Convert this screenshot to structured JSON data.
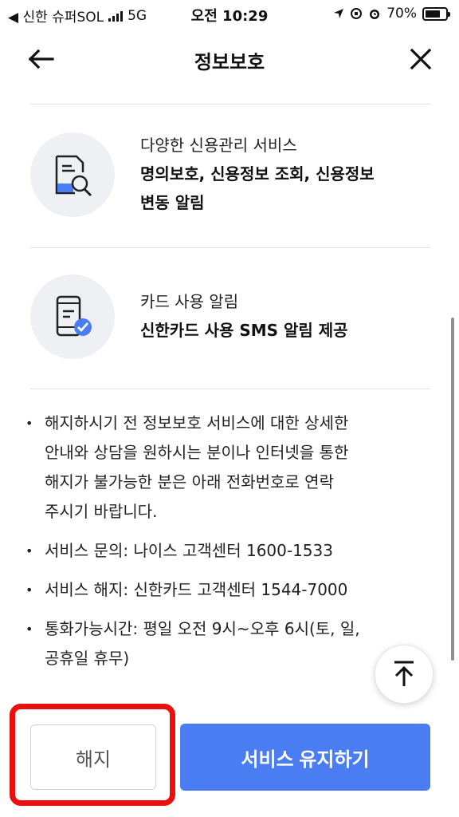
{
  "status_bar": {
    "carrier": "◀ 신한 슈퍼SOL",
    "network": "5G",
    "time": "오전 10:29",
    "battery": "70%"
  },
  "header": {
    "title": "정보보호"
  },
  "features": [
    {
      "icon": "document-search-icon",
      "subtitle": "다양한 신용관리 서비스",
      "title_line1": "명의보호, 신용정보 조회, 신용정보",
      "title_line2": "변동 알림"
    },
    {
      "icon": "phone-check-icon",
      "subtitle": "카드 사용 알림",
      "title_line1": "신한카드 사용 SMS 알림 제공"
    }
  ],
  "notes": {
    "items": [
      [
        "해지하시기 전 정보보호 서비스에 대한 상세한",
        "안내와 상담을 원하시는 분이나 인터넷을 통한",
        "해지가 불가능한 분은 아래 전화번호로 연락",
        "주시기 바랍니다."
      ],
      [
        "서비스 문의: 나이스 고객센터 1600-1533"
      ],
      [
        "서비스 해지: 신한카드 고객센터 1544-7000"
      ],
      [
        "통화가능시간: 평일 오전 9시~오후 6시(토, 일,",
        "공휴일 휴무)"
      ]
    ]
  },
  "buttons": {
    "cancel_label": "해지",
    "keep_label": "서비스 유지하기"
  },
  "colors": {
    "accent": "#4a7cf2",
    "highlight": "#ea1010",
    "icon_circle": "#eef0f4"
  }
}
